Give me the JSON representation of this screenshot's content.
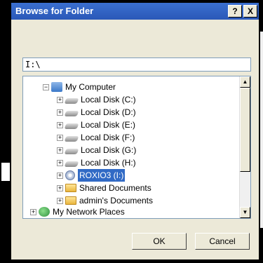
{
  "dialog": {
    "title": "Browse for Folder",
    "help_label": "?",
    "close_label": "X",
    "path_value": "I:\\",
    "tree": [
      {
        "label": "My Computer",
        "icon": "computer-icon",
        "expander": "−"
      },
      {
        "label": "Local Disk (C:)",
        "icon": "disk-icon",
        "expander": "+"
      },
      {
        "label": "Local Disk (D:)",
        "icon": "disk-icon",
        "expander": "+"
      },
      {
        "label": "Local Disk (E:)",
        "icon": "disk-icon",
        "expander": "+"
      },
      {
        "label": "Local Disk (F:)",
        "icon": "disk-icon",
        "expander": "+"
      },
      {
        "label": "Local Disk (G:)",
        "icon": "disk-icon",
        "expander": "+"
      },
      {
        "label": "Local Disk (H:)",
        "icon": "disk-icon",
        "expander": "+"
      },
      {
        "label": "ROXIO3 (I:)",
        "icon": "cd-icon",
        "expander": "+",
        "selected": true
      },
      {
        "label": "Shared Documents",
        "icon": "folder-icon",
        "expander": "+"
      },
      {
        "label": "admin's Documents",
        "icon": "folder-icon",
        "expander": "+"
      },
      {
        "label": "My Network Places",
        "icon": "network-icon",
        "expander": "+"
      }
    ],
    "ok_label": "OK",
    "cancel_label": "Cancel"
  },
  "colors": {
    "title_bar": "#2a58b8",
    "selection": "#316ac5",
    "dialog_face": "#ece9d8"
  }
}
